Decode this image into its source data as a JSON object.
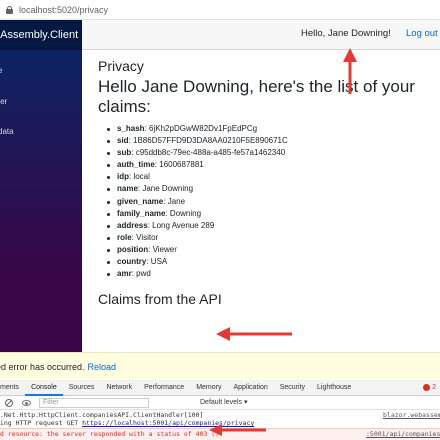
{
  "browser": {
    "url": "localhost:5020/privacy"
  },
  "sidebar": {
    "brand": "bAssembly.Client",
    "items": [
      {
        "label": "e"
      },
      {
        "label": "ter"
      },
      {
        "label": "data"
      }
    ]
  },
  "topbar": {
    "greeting": "Hello, Jane Downing!",
    "logout": "Log out"
  },
  "main": {
    "page_title": "Privacy",
    "heading": "Hello Jane Downing, here's the list of your claims:",
    "claims": [
      {
        "key": "s_hash",
        "value": "6jKh2pDGwW82Dv1FpEdPCg"
      },
      {
        "key": "sid",
        "value": "1B86D57FFD9D3DA8AA0210F5E890671C"
      },
      {
        "key": "sub",
        "value": "c95ddb8c-79ec-488a-a485-fe57a1462340"
      },
      {
        "key": "auth_time",
        "value": "1600687881"
      },
      {
        "key": "idp",
        "value": "local"
      },
      {
        "key": "name",
        "value": "Jane Downing"
      },
      {
        "key": "given_name",
        "value": "Jane"
      },
      {
        "key": "family_name",
        "value": "Downing"
      },
      {
        "key": "address",
        "value": "Long Avenue 289"
      },
      {
        "key": "role",
        "value": "Visitor"
      },
      {
        "key": "position",
        "value": "Viewer"
      },
      {
        "key": "country",
        "value": "USA"
      },
      {
        "key": "amr",
        "value": "pwd"
      }
    ],
    "api_title": "Claims from the API"
  },
  "error_bar": {
    "message": "ed error has occurred.",
    "reload": "Reload"
  },
  "devtools": {
    "tabs": [
      "ments",
      "Console",
      "Sources",
      "Network",
      "Performance",
      "Memory",
      "Application",
      "Security",
      "Lighthouse"
    ],
    "active_tab": "Console",
    "error_count": "2",
    "filter_placeholder": "Filter",
    "levels": "Default levels ▾",
    "log_line_1": "n.Net.Http.HttpClient.companiesAPI.ClientHandler[100]",
    "log_line_2_prefix": "ding HTTP request GET ",
    "log_line_2_link": "https://localhost:5001/api/companies/privacy",
    "log_source_1": "blazor.webassem",
    "log_error": "ad resource: the server responded with a status of 403 ()",
    "log_source_2": ":5001/api/companies/pri"
  },
  "colors": {
    "accent_arrow": "#e53935",
    "link": "#0366d6",
    "sidebar_top": "#052767",
    "sidebar_bottom": "#3a0647"
  }
}
